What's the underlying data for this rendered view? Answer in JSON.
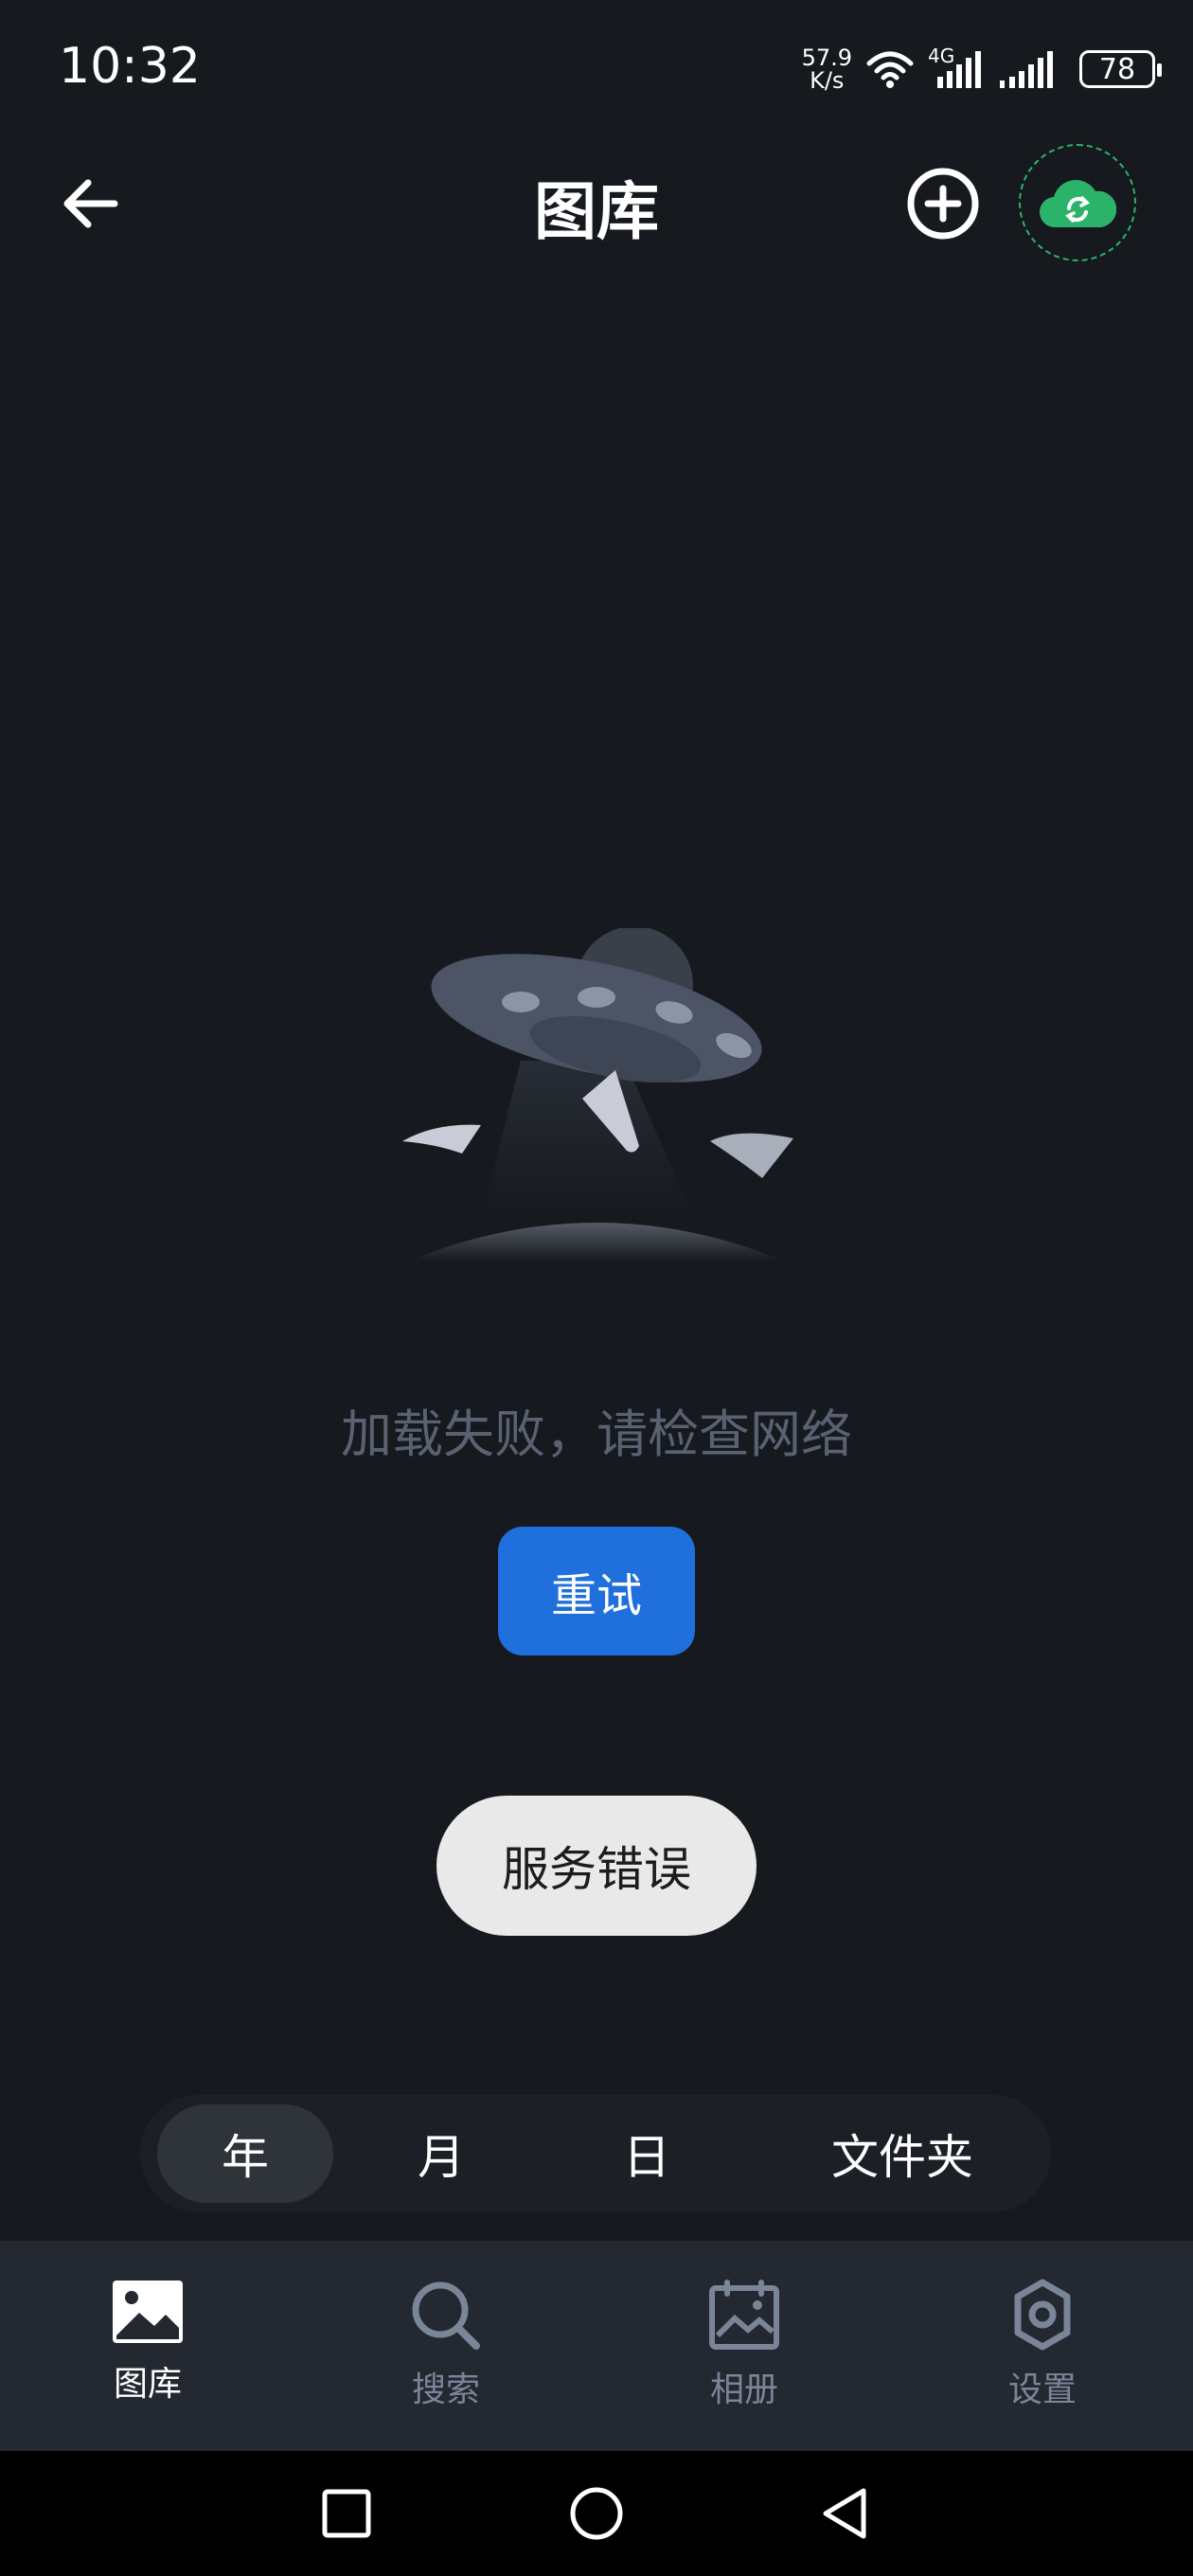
{
  "status_bar": {
    "time": "10:32",
    "net_speed_value": "57.9",
    "net_speed_unit": "K/s",
    "network_type": "4G",
    "battery": "78"
  },
  "header": {
    "title": "图库",
    "back_icon": "arrow-left-icon",
    "add_icon": "plus-circle-icon",
    "sync_icon": "cloud-sync-icon"
  },
  "empty_state": {
    "message": "加载失败，请检查网络",
    "retry_label": "重试",
    "illustration": "ufo-icon"
  },
  "toast": {
    "text": "服务错误"
  },
  "view_tabs": [
    {
      "label": "年",
      "selected": true
    },
    {
      "label": "月",
      "selected": false
    },
    {
      "label": "日",
      "selected": false
    },
    {
      "label": "文件夹",
      "selected": false
    }
  ],
  "bottom_nav": [
    {
      "label": "图库",
      "icon": "image-icon",
      "active": true
    },
    {
      "label": "搜索",
      "icon": "search-icon",
      "active": false
    },
    {
      "label": "相册",
      "icon": "album-icon",
      "active": false
    },
    {
      "label": "设置",
      "icon": "gear-icon",
      "active": false
    }
  ],
  "colors": {
    "background": "#16191e",
    "accent_blue": "#1f6fdc",
    "accent_green": "#2cb36a",
    "inactive_nav": "#7a8597"
  }
}
